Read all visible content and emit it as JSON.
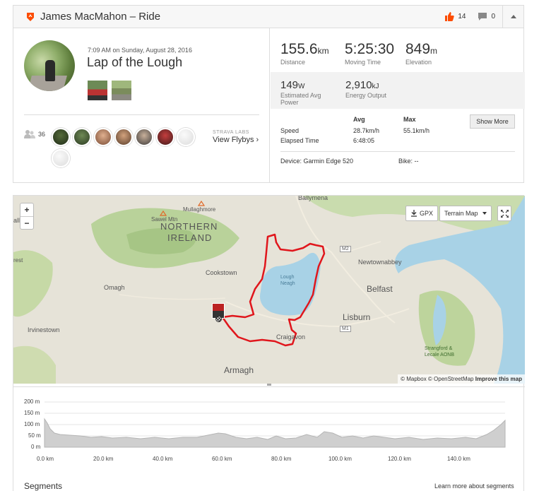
{
  "header": {
    "title": "James MacMahon – Ride",
    "kudos_count": "14",
    "comment_count": "0",
    "brand_color": "#fc4c02"
  },
  "activity": {
    "datetime": "7:09 AM on Sunday, August 28, 2016",
    "name": "Lap of the Lough",
    "athlete_count": "36",
    "flyby_lab": "STRAVA LABS",
    "flyby_link": "View Flybys ›"
  },
  "stats": {
    "distance": {
      "value": "155.6",
      "unit": "km",
      "label": "Distance"
    },
    "moving_time": {
      "value": "5:25:30",
      "unit": "",
      "label": "Moving Time"
    },
    "elevation": {
      "value": "849",
      "unit": "m",
      "label": "Elevation"
    },
    "power": {
      "value": "149",
      "unit": "W",
      "label": "Estimated Avg Power"
    },
    "energy": {
      "value": "2,910",
      "unit": "kJ",
      "label": "Energy Output"
    }
  },
  "detail_table": {
    "col_avg": "Avg",
    "col_max": "Max",
    "speed_label": "Speed",
    "speed_avg": "28.7km/h",
    "speed_max": "55.1km/h",
    "elapsed_label": "Elapsed Time",
    "elapsed_avg": "6:48:05",
    "show_more": "Show More",
    "device": "Device: Garmin Edge 520",
    "bike": "Bike: --"
  },
  "map": {
    "gpx_label": "GPX",
    "terrain_label": "Terrain Map",
    "zoom_in": "+",
    "zoom_out": "−",
    "attribution_prefix": "© Mapbox © OpenStreetMap",
    "attribution_link": "Improve this map",
    "route_color": "#e0161c",
    "places": {
      "ballymena": "Ballymena",
      "mullaghmore": "Mullaghmore",
      "sawel": "Sawel Mtn",
      "northern": "NORTHERN",
      "ireland": "IRELAND",
      "cookstown": "Cookstown",
      "omagh": "Omagh",
      "irvinestown": "Irvinestown",
      "newtownabbey": "Newtownabbey",
      "belfast": "Belfast",
      "lisburn": "Lisburn",
      "craigavon": "Craigavon",
      "armagh": "Armagh",
      "strangford1": "Strangford &",
      "strangford2": "Lecale AONB",
      "lough_neagh1": "Lough",
      "lough_neagh2": "Neagh",
      "m2": "M2",
      "m1": "M1",
      "edge_west1": "ally",
      "edge_west2": "rest"
    }
  },
  "elevation_chart": {
    "y_ticks": [
      "200 m",
      "150 m",
      "100 m",
      "50 m",
      "0 m"
    ],
    "x_ticks": [
      "0.0 km",
      "20.0 km",
      "40.0 km",
      "60.0 km",
      "80.0 km",
      "100.0 km",
      "120.0 km",
      "140.0 km"
    ]
  },
  "footer": {
    "segments_title": "Segments",
    "learn_more": "Learn more about segments"
  }
}
